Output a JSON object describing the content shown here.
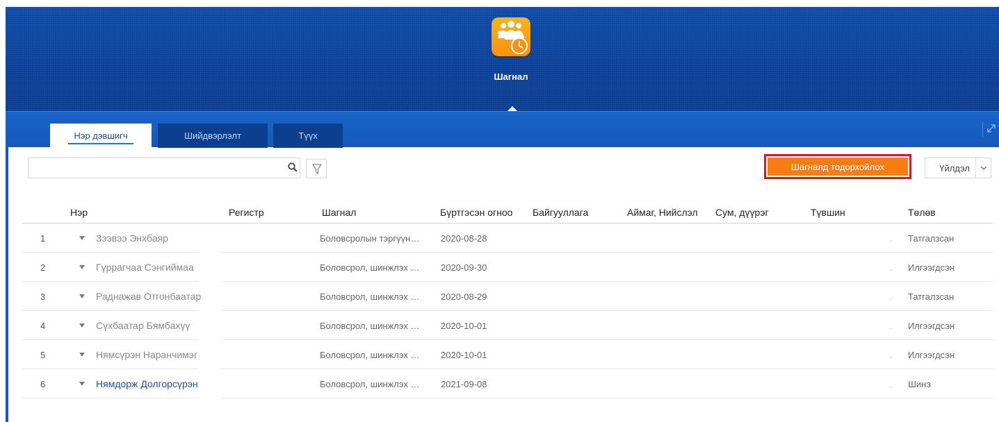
{
  "header": {
    "app_title": "Шагнал",
    "icon": "award-group-clock-icon",
    "colors": {
      "header_blue": "#0b3f9b",
      "icon_orange": "#f7920e"
    }
  },
  "tabs": [
    {
      "label": "Нэр дэвшигч",
      "active": true
    },
    {
      "label": "Шийдвэрлэлт",
      "active": false
    },
    {
      "label": "Түүх",
      "active": false
    }
  ],
  "toolbar": {
    "search_placeholder": "",
    "primary_button": "Шагналд тодорхойлох",
    "primary_button_color": "#f77d13",
    "highlight_color": "#e4141c",
    "action_select": "Үйлдэл"
  },
  "table": {
    "columns": [
      "Нэр",
      "Регистр",
      "Шагнал",
      "Бүртгэсэн огноо",
      "Байгууллага",
      "Аймаг, Нийслэл",
      "Сум, дүүрэг",
      "Түвшин",
      "Төлөв"
    ],
    "rows": [
      {
        "num": "1",
        "name": "Зээвээ Энхбаяр",
        "register": "",
        "award": "Боловсролын тэргүүн…",
        "date": "2020-08-28",
        "org": "",
        "aimag": "",
        "sum": "",
        "level": "",
        "dot": ".",
        "status": "Татгалзсан",
        "is_new": false
      },
      {
        "num": "2",
        "name": "Гүррагчаа Сэнгиймаа",
        "register": "",
        "award": "Боловсрол, шинжлэх …",
        "date": "2020-09-30",
        "org": "",
        "aimag": "",
        "sum": "",
        "level": "",
        "dot": ".",
        "status": "Илгээгдсэн",
        "is_new": false
      },
      {
        "num": "3",
        "name": "Раднажав Отгонбаатар",
        "register": "",
        "award": "Боловсрол, шинжлэх …",
        "date": "2020-08-29",
        "org": "",
        "aimag": "",
        "sum": "",
        "level": "",
        "dot": ".",
        "status": "Татгалзсан",
        "is_new": false
      },
      {
        "num": "4",
        "name": "Сүхбаатар Бямбахүү",
        "register": "",
        "award": "Боловсрол, шинжлэх …",
        "date": "2020-10-01",
        "org": "",
        "aimag": "",
        "sum": "",
        "level": "",
        "dot": ".",
        "status": "Илгээгдсэн",
        "is_new": false
      },
      {
        "num": "5",
        "name": "Нямсүрэн Наранчимэг",
        "register": "",
        "award": "Боловсрол, шинжлэх …",
        "date": "2020-10-01",
        "org": "",
        "aimag": "",
        "sum": "",
        "level": "",
        "dot": ".",
        "status": "Илгээгдсэн",
        "is_new": false
      },
      {
        "num": "6",
        "name": "Нямдорж Долгорсүрэн",
        "register": "",
        "award": "Боловсрол, шинжлэх …",
        "date": "2021-09-08",
        "org": "",
        "aimag": "",
        "sum": "",
        "level": "",
        "dot": ".",
        "status": "Шинэ",
        "is_new": true
      }
    ]
  }
}
